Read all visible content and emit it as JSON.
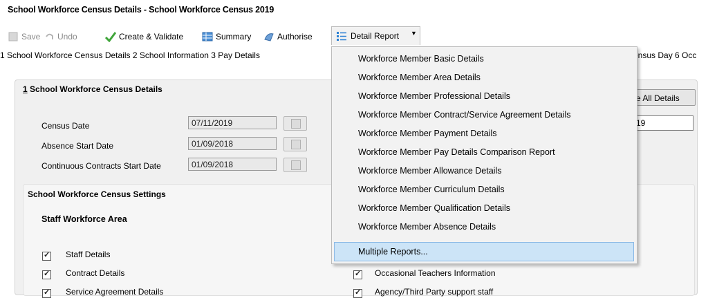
{
  "window": {
    "title": "School Workforce Census Details - School Workforce Census 2019"
  },
  "toolbar": {
    "save": "Save",
    "undo": "Undo",
    "create_validate": "Create & Validate",
    "summary": "Summary",
    "authorise": "Authorise",
    "detail_report": "Detail Report"
  },
  "tabs": {
    "left": "1 School Workforce Census Details   2 School Information   3 Pay Details",
    "right": "ensus Day   6 Occ"
  },
  "section1": {
    "heading_num": "1",
    "heading_text": " School Workforce Census Details",
    "fields": [
      {
        "label": "Census Date",
        "value": "07/11/2019"
      },
      {
        "label": "Absence Start Date",
        "value": "01/09/2018"
      },
      {
        "label": "Continuous Contracts Start Date",
        "value": "01/09/2018"
      }
    ],
    "all_details_btn": "e All Details",
    "right_field_value": "19"
  },
  "settings": {
    "heading": "School Workforce Census Settings",
    "subheading": "Staff Workforce Area",
    "left_items": [
      "Staff Details",
      "Contract Details",
      "Service Agreement Details"
    ],
    "right_items": [
      "Occasional Teachers Information",
      "Agency/Third Party support staff"
    ]
  },
  "menu": {
    "items": [
      "Workforce Member Basic Details",
      "Workforce Member Area Details",
      "Workforce Member Professional Details",
      "Workforce Member Contract/Service Agreement Details",
      "Workforce Member Payment Details",
      "Workforce Member Pay Details Comparison Report",
      "Workforce Member Allowance Details",
      "Workforce Member Curriculum Details",
      "Workforce Member Qualification Details",
      "Workforce Member Absence Details"
    ],
    "highlighted": "Multiple Reports..."
  }
}
